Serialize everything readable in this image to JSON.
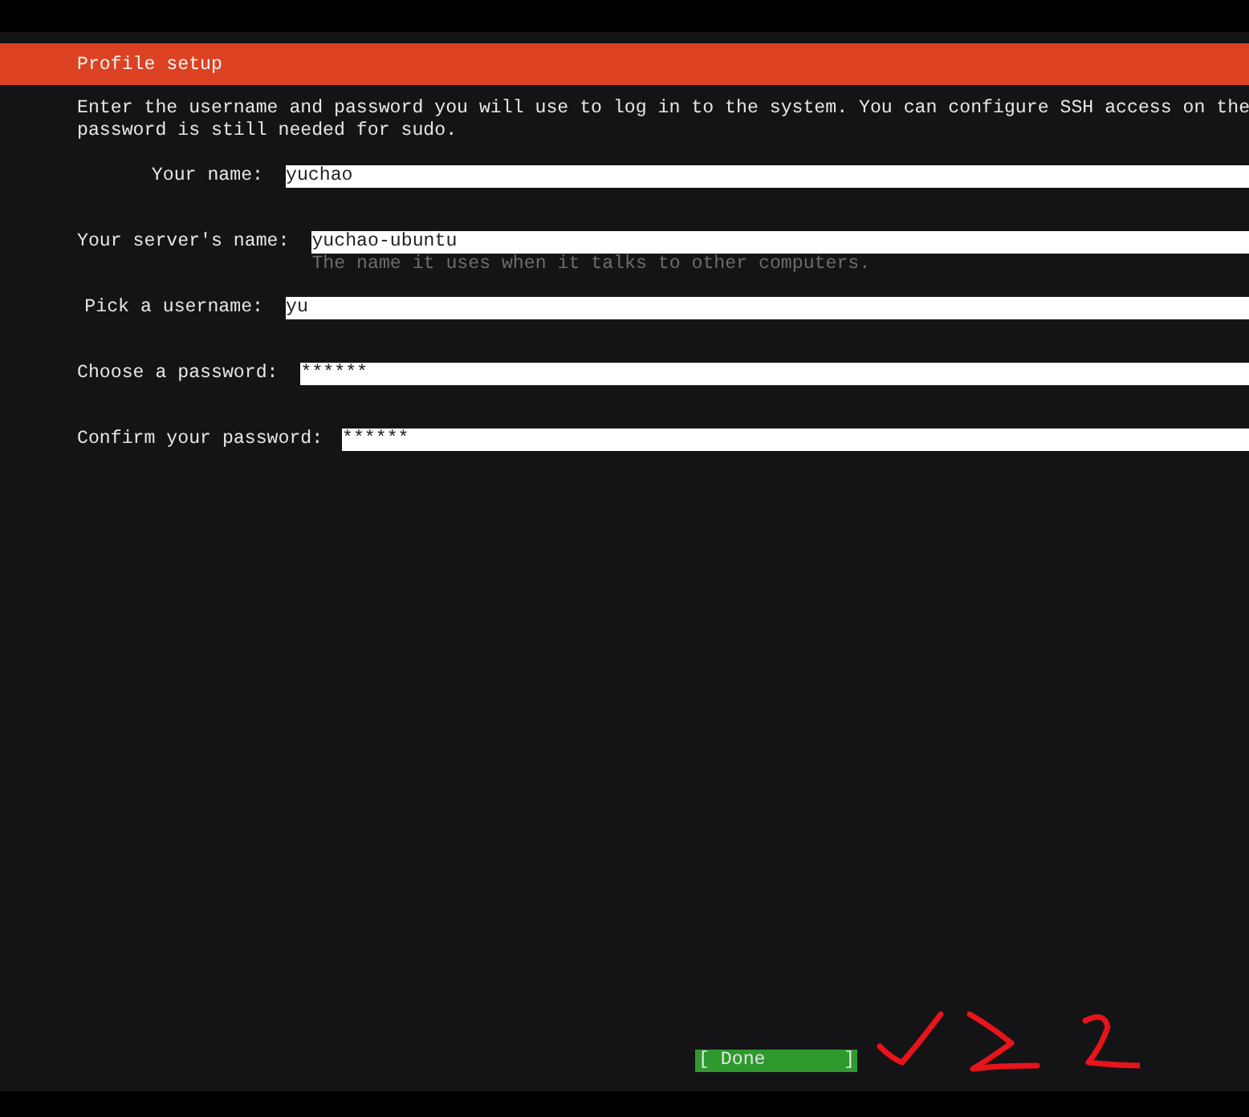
{
  "header": {
    "title": "Profile setup"
  },
  "description": "Enter the username and password you will use to log in to the system. You can configure SSH access on the\npassword is still needed for sudo.",
  "fields": [
    {
      "label": "Your name:",
      "value": "yuchao"
    },
    {
      "label": "Your server's name:",
      "value": "yuchao-ubuntu",
      "hint": "The name it uses when it talks to other computers."
    },
    {
      "label": "Pick a username:",
      "value": "yu"
    },
    {
      "label": "Choose a password:",
      "value": "******"
    },
    {
      "label": "Confirm your password:",
      "value": "******"
    }
  ],
  "done_button": {
    "label": "[ Done       ]"
  }
}
